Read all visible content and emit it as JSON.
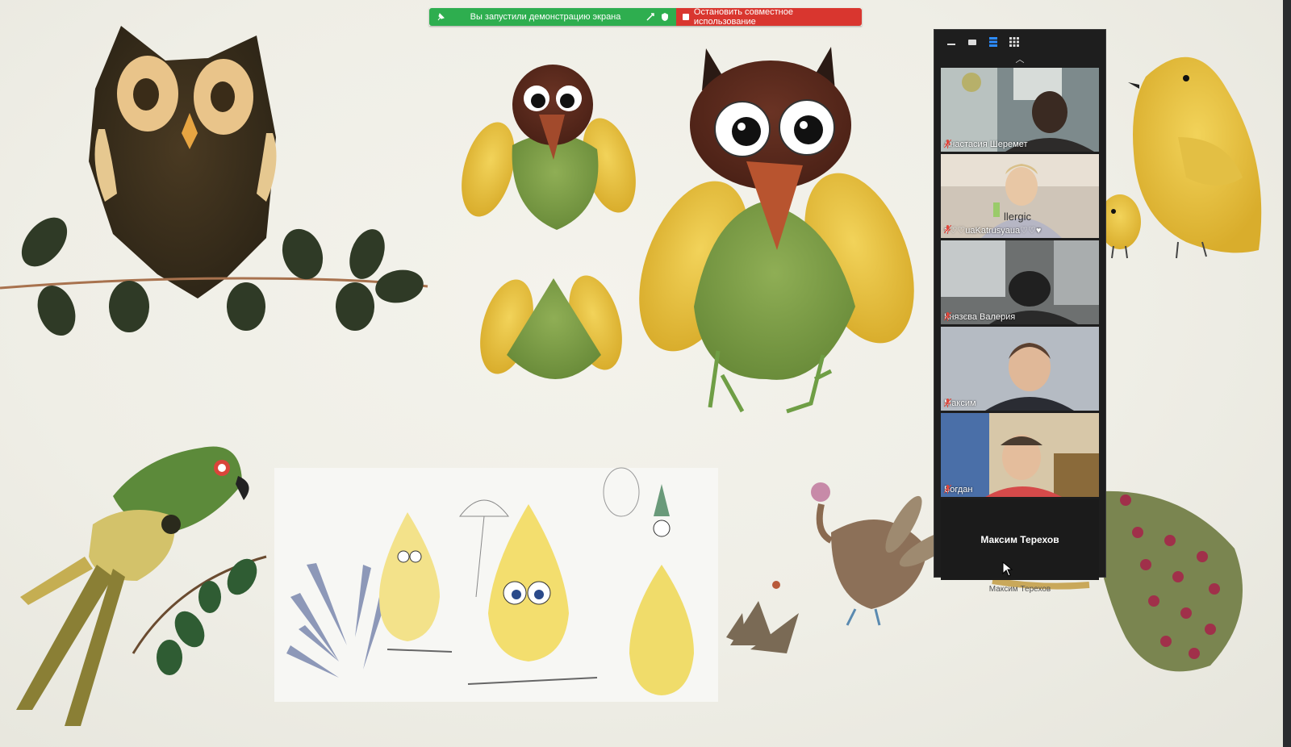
{
  "share_bar": {
    "status_text": "Вы запустили демонстрацию экрана",
    "stop_label": "Остановить совместное использование"
  },
  "panel": {
    "participants": [
      {
        "name": "Анастасия Шеремет",
        "muted": true
      },
      {
        "name": "♥♡♡uaKatrusyaua♡♡♥",
        "muted": true
      },
      {
        "name": "Князєва Валерия",
        "muted": true
      },
      {
        "name": "Максим",
        "muted": true
      },
      {
        "name": "Богдан",
        "muted": true
      }
    ],
    "active_speaker": "Максим Терехов",
    "footer_name": "Максим Терехов"
  },
  "colors": {
    "green_bar": "#2eae4f",
    "red_bar": "#d9362f",
    "panel_bg": "#1e1e1e",
    "mic_muted": "#e0463b"
  }
}
